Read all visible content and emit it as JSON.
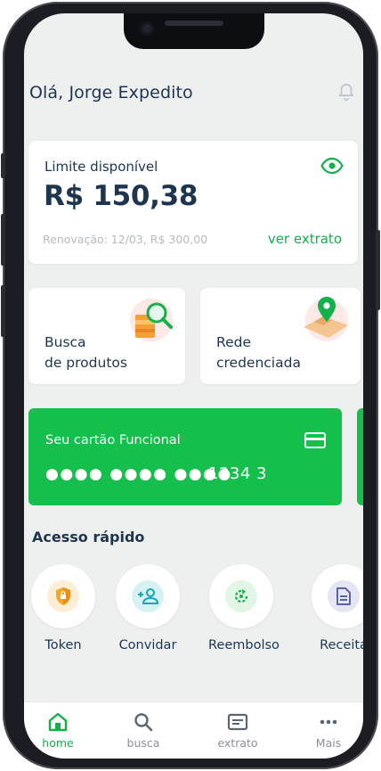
{
  "header": {
    "greeting": "Olá, Jorge Expedito",
    "bell_icon": "bell-icon"
  },
  "limit_card": {
    "label": "Limite disponível",
    "value": "R$ 150,38",
    "renewal": "Renovação: 12/03, R$ 300,00",
    "extract_link": "ver extrato",
    "eye_icon": "eye-icon"
  },
  "shortcuts": [
    {
      "label": "Busca\nde produtos",
      "icon": "search-products-icon"
    },
    {
      "label": "Rede\ncredenciada",
      "icon": "map-pin-icon"
    }
  ],
  "card": {
    "title": "Seu cartão Funcional",
    "masked": "●●●●  ●●●●  ●●●●",
    "number": "1234  3",
    "icon": "credit-card-icon"
  },
  "quick_access": {
    "title": "Acesso rápido",
    "items": [
      {
        "label": "Token",
        "icon": "shield-icon"
      },
      {
        "label": "Convidar",
        "icon": "add-user-icon"
      },
      {
        "label": "Reembolso",
        "icon": "refund-icon"
      },
      {
        "label": "Receita",
        "icon": "document-icon"
      }
    ]
  },
  "tabbar": {
    "tabs": [
      {
        "label": "home",
        "icon": "home-icon",
        "active": true
      },
      {
        "label": "busca",
        "icon": "search-icon"
      },
      {
        "label": "extrato",
        "icon": "receipt-icon"
      },
      {
        "label": "Mais",
        "icon": "more-icon"
      }
    ]
  },
  "colors": {
    "accent": "#14c04b",
    "text": "#1e3550",
    "background": "#eef0f0"
  }
}
